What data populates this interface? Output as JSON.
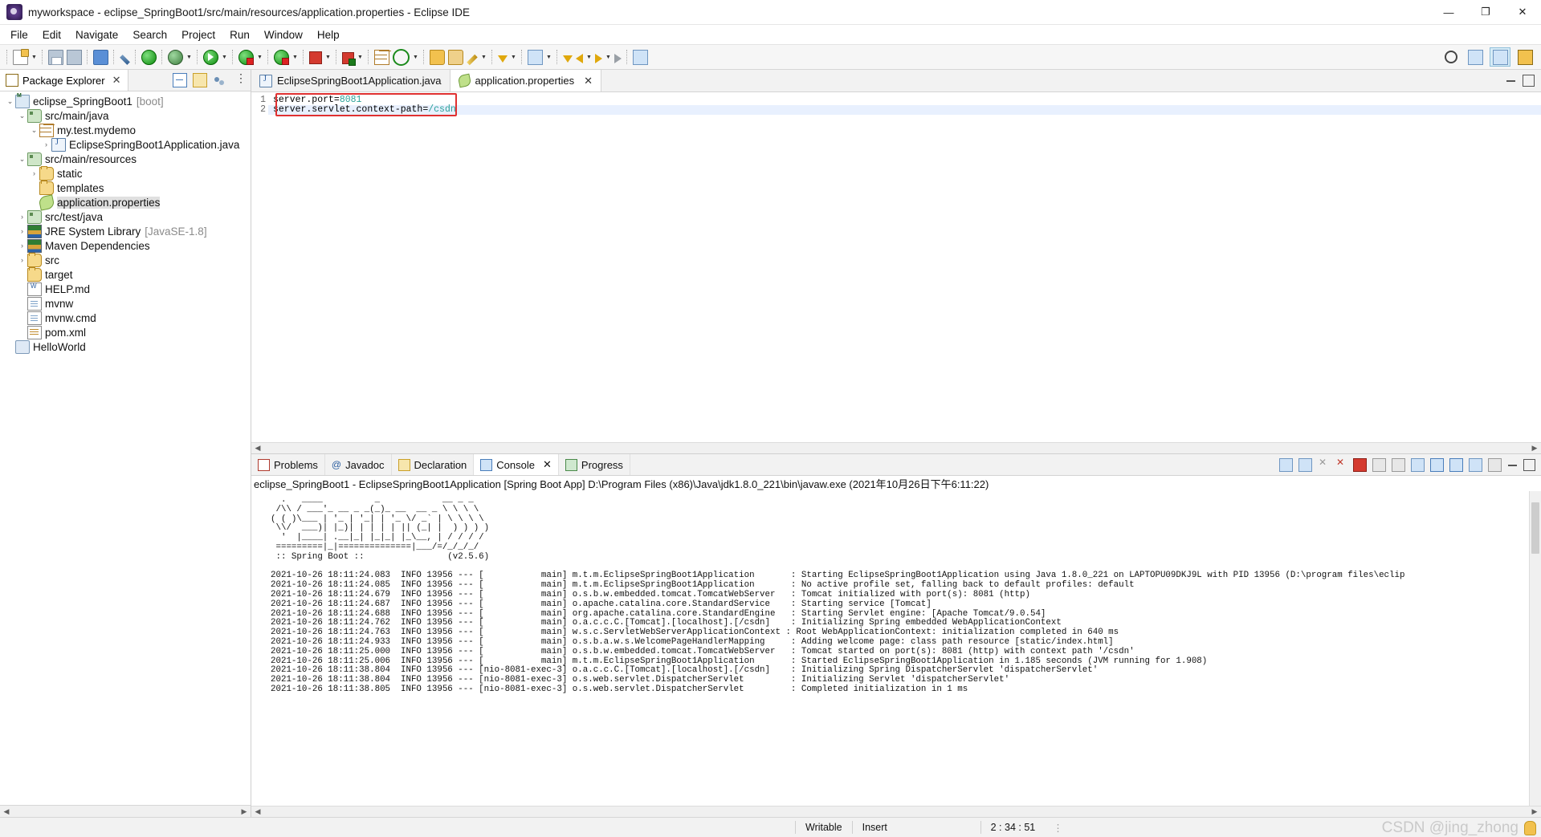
{
  "window": {
    "title": "myworkspace - eclipse_SpringBoot1/src/main/resources/application.properties - Eclipse IDE",
    "app_icon": "eclipse-icon",
    "minimize": "—",
    "maximize": "❐",
    "close": "✕"
  },
  "menu": [
    "File",
    "Edit",
    "Navigate",
    "Search",
    "Project",
    "Run",
    "Window",
    "Help"
  ],
  "toolbar": {
    "icons": [
      "new-document-icon",
      "save-icon",
      "save-all-icon",
      "print-icon",
      "quick-access-icon",
      "external-tools-icon",
      "debug-icon",
      "run-icon",
      "run-as-icon",
      "coverage-icon",
      "terminate-icon",
      "stop-icon",
      "new-java-class-icon",
      "refresh-icon",
      "open-type-icon",
      "open-task-icon",
      "annotate-icon",
      "next-annotation-icon",
      "previous-annotation-icon",
      "back-icon",
      "forward-icon",
      "pin-editor-icon"
    ],
    "right_icons": [
      "search-icon",
      "open-perspective-icon",
      "java-perspective-icon",
      "java-ee-perspective-icon"
    ]
  },
  "explorer": {
    "tab_label": "Package Explorer",
    "tab_close": "✕",
    "tools": [
      "collapse-all-icon",
      "link-with-editor-icon",
      "focus-on-active-task-icon",
      "view-menu-icon"
    ],
    "tree": [
      {
        "indent": 0,
        "twist": "⌄",
        "icon": "project-icon",
        "icon_cls": "ti-proj",
        "label": "eclipse_SpringBoot1",
        "sub": "[boot]"
      },
      {
        "indent": 1,
        "twist": "⌄",
        "icon": "source-folder-icon",
        "icon_cls": "ti-srcfolder",
        "label": "src/main/java",
        "sub": ""
      },
      {
        "indent": 2,
        "twist": "⌄",
        "icon": "package-icon",
        "icon_cls": "ti-pkg",
        "label": "my.test.mydemo",
        "sub": ""
      },
      {
        "indent": 3,
        "twist": "›",
        "icon": "java-file-icon",
        "icon_cls": "ti-java",
        "label": "EclipseSpringBoot1Application.java",
        "sub": ""
      },
      {
        "indent": 1,
        "twist": "⌄",
        "icon": "source-folder-icon",
        "icon_cls": "ti-srcfolder",
        "label": "src/main/resources",
        "sub": ""
      },
      {
        "indent": 2,
        "twist": "›",
        "icon": "folder-icon",
        "icon_cls": "ti-folder",
        "label": "static",
        "sub": ""
      },
      {
        "indent": 2,
        "twist": "",
        "icon": "folder-icon",
        "icon_cls": "ti-folder",
        "label": "templates",
        "sub": ""
      },
      {
        "indent": 2,
        "twist": "",
        "icon": "properties-file-icon",
        "icon_cls": "ti-leaf",
        "label": "application.properties",
        "sub": "",
        "selected": true
      },
      {
        "indent": 1,
        "twist": "›",
        "icon": "source-folder-icon",
        "icon_cls": "ti-srcfolder",
        "label": "src/test/java",
        "sub": ""
      },
      {
        "indent": 1,
        "twist": "›",
        "icon": "library-icon",
        "icon_cls": "ti-lib",
        "label": "JRE System Library",
        "sub": "[JavaSE-1.8]"
      },
      {
        "indent": 1,
        "twist": "›",
        "icon": "library-icon",
        "icon_cls": "ti-lib",
        "label": "Maven Dependencies",
        "sub": ""
      },
      {
        "indent": 1,
        "twist": "›",
        "icon": "folder-icon",
        "icon_cls": "ti-folder",
        "label": "src",
        "sub": ""
      },
      {
        "indent": 1,
        "twist": "",
        "icon": "folder-icon",
        "icon_cls": "ti-folder",
        "label": "target",
        "sub": ""
      },
      {
        "indent": 1,
        "twist": "",
        "icon": "markdown-file-icon",
        "icon_cls": "ti-md",
        "label": "HELP.md",
        "sub": ""
      },
      {
        "indent": 1,
        "twist": "",
        "icon": "file-icon",
        "icon_cls": "ti-file",
        "label": "mvnw",
        "sub": ""
      },
      {
        "indent": 1,
        "twist": "",
        "icon": "file-icon",
        "icon_cls": "ti-file",
        "label": "mvnw.cmd",
        "sub": ""
      },
      {
        "indent": 1,
        "twist": "",
        "icon": "xml-file-icon",
        "icon_cls": "ti-xml",
        "label": "pom.xml",
        "sub": ""
      },
      {
        "indent": 0,
        "twist": "",
        "icon": "java-project-icon",
        "icon_cls": "ti-jproj",
        "label": "HelloWorld",
        "sub": ""
      }
    ]
  },
  "editor": {
    "tabs": [
      {
        "label": "EclipseSpringBoot1Application.java",
        "icon": "java-file-icon",
        "active": false,
        "closable": false
      },
      {
        "label": "application.properties",
        "icon": "properties-file-icon",
        "active": true,
        "closable": true
      }
    ],
    "tab_close": "✕",
    "minimize": "minimize-icon",
    "maximize": "maximize-icon",
    "line_numbers": [
      "1",
      "2"
    ],
    "lines": [
      {
        "key": "server.port=",
        "value": "8081"
      },
      {
        "key": "server.servlet.context-path=",
        "value": "/csdn"
      }
    ],
    "highlight_color": "#e03131"
  },
  "console": {
    "tabs": [
      {
        "label": "Problems",
        "icon": "problems-icon",
        "active": false,
        "closable": false
      },
      {
        "label": "Javadoc",
        "icon": "javadoc-icon",
        "active": false,
        "closable": false
      },
      {
        "label": "Declaration",
        "icon": "declaration-icon",
        "active": false,
        "closable": false
      },
      {
        "label": "Console",
        "icon": "console-icon",
        "active": true,
        "closable": true
      },
      {
        "label": "Progress",
        "icon": "progress-icon",
        "active": false,
        "closable": false
      }
    ],
    "tab_close": "✕",
    "tools": [
      "terminate-icon",
      "remove-launch-icon",
      "remove-all-terminated-icon",
      "stop-icon",
      "display-selected-console-icon",
      "open-console-icon",
      "scroll-lock-icon",
      "word-wrap-icon",
      "pin-console-icon",
      "new-console-view-icon",
      "console-menu-icon",
      "minimize-icon",
      "maximize-icon"
    ],
    "title": "eclipse_SpringBoot1 - EclipseSpringBoot1Application [Spring Boot App] D:\\Program Files (x86)\\Java\\jdk1.8.0_221\\bin\\javaw.exe  (2021年10月26日下午6:11:22)",
    "banner": "  .   ____          _            __ _ _\n /\\\\ / ___'_ __ _ _(_)_ __  __ _ \\ \\ \\ \\\n( ( )\\___ | '_ | '_| | '_ \\/ _` | \\ \\ \\ \\\n \\\\/  ___)| |_)| | | | | || (_| |  ) ) ) )\n  '  |____| .__|_| |_|_| |_\\__, | / / / /\n =========|_|==============|___/=/_/_/_/\n :: Spring Boot ::                (v2.5.6)",
    "log": [
      "2021-10-26 18:11:24.083  INFO 13956 --- [           main] m.t.m.EclipseSpringBoot1Application       : Starting EclipseSpringBoot1Application using Java 1.8.0_221 on LAPTOPU09DKJ9L with PID 13956 (D:\\program files\\eclip",
      "2021-10-26 18:11:24.085  INFO 13956 --- [           main] m.t.m.EclipseSpringBoot1Application       : No active profile set, falling back to default profiles: default",
      "2021-10-26 18:11:24.679  INFO 13956 --- [           main] o.s.b.w.embedded.tomcat.TomcatWebServer   : Tomcat initialized with port(s): 8081 (http)",
      "2021-10-26 18:11:24.687  INFO 13956 --- [           main] o.apache.catalina.core.StandardService    : Starting service [Tomcat]",
      "2021-10-26 18:11:24.688  INFO 13956 --- [           main] org.apache.catalina.core.StandardEngine   : Starting Servlet engine: [Apache Tomcat/9.0.54]",
      "2021-10-26 18:11:24.762  INFO 13956 --- [           main] o.a.c.c.C.[Tomcat].[localhost].[/csdn]    : Initializing Spring embedded WebApplicationContext",
      "2021-10-26 18:11:24.763  INFO 13956 --- [           main] w.s.c.ServletWebServerApplicationContext : Root WebApplicationContext: initialization completed in 640 ms",
      "2021-10-26 18:11:24.933  INFO 13956 --- [           main] o.s.b.a.w.s.WelcomePageHandlerMapping     : Adding welcome page: class path resource [static/index.html]",
      "2021-10-26 18:11:25.000  INFO 13956 --- [           main] o.s.b.w.embedded.tomcat.TomcatWebServer   : Tomcat started on port(s): 8081 (http) with context path '/csdn'",
      "2021-10-26 18:11:25.006  INFO 13956 --- [           main] m.t.m.EclipseSpringBoot1Application       : Started EclipseSpringBoot1Application in 1.185 seconds (JVM running for 1.908)",
      "2021-10-26 18:11:38.804  INFO 13956 --- [nio-8081-exec-3] o.a.c.c.C.[Tomcat].[localhost].[/csdn]    : Initializing Spring DispatcherServlet 'dispatcherServlet'",
      "2021-10-26 18:11:38.804  INFO 13956 --- [nio-8081-exec-3] o.s.web.servlet.DispatcherServlet         : Initializing Servlet 'dispatcherServlet'",
      "2021-10-26 18:11:38.805  INFO 13956 --- [nio-8081-exec-3] o.s.web.servlet.DispatcherServlet         : Completed initialization in 1 ms"
    ]
  },
  "statusbar": {
    "writable": "Writable",
    "insert": "Insert",
    "position": "2 : 34 : 51",
    "dots": "⋮",
    "watermark": "CSDN @jing_zhong"
  }
}
